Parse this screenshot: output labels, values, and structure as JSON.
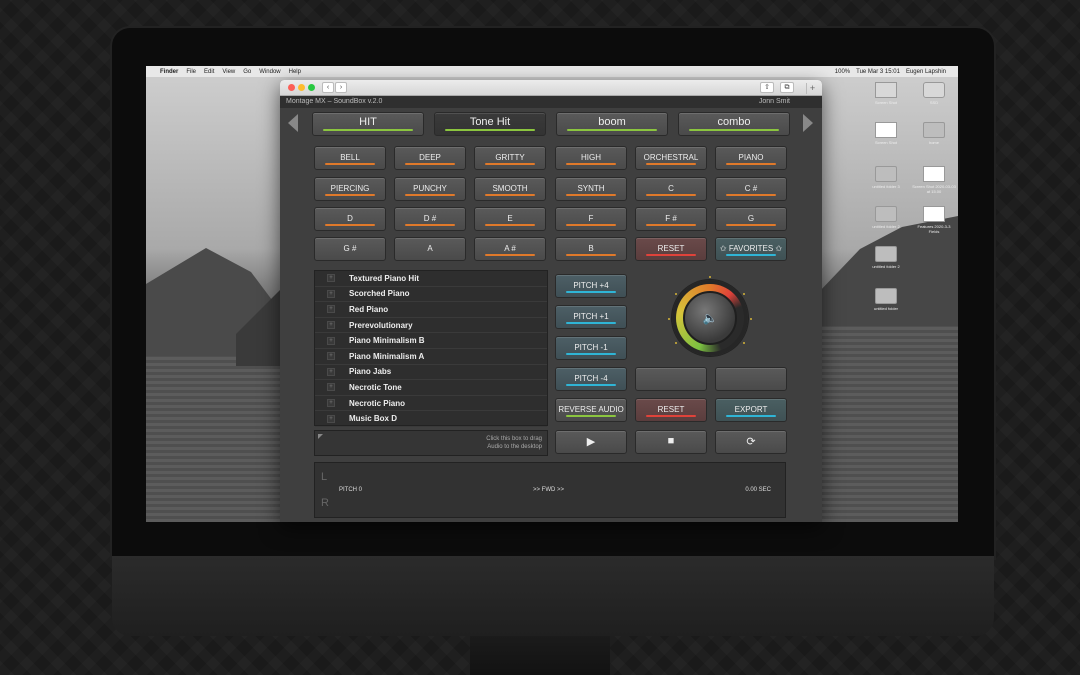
{
  "menubar": {
    "apple": "",
    "items": [
      "Finder",
      "File",
      "Edit",
      "View",
      "Go",
      "Window",
      "Help"
    ],
    "right": [
      "100%",
      "Tue Mar 3  15:01",
      "Eugen Lapshin"
    ]
  },
  "desktop": {
    "icons": [
      "Screen Shot",
      "SSD",
      "Screen Shot",
      "home",
      "untitled folder 3",
      "Screen Shot 2020-03-03 at 15.00",
      "untitled folder 2",
      "Features 2020-3-3 Fields",
      "untitled folder 2",
      "untitled folder"
    ]
  },
  "app": {
    "title": "Montage MX – SoundBox v.2.0",
    "user": "Jonn Smit",
    "categories": [
      {
        "label": "HIT",
        "bar": "green"
      },
      {
        "label": "Tone Hit",
        "bar": "green",
        "active": true
      },
      {
        "label": "boom",
        "bar": "green"
      },
      {
        "label": "combo",
        "bar": "green"
      }
    ],
    "tags": [
      [
        "BELL",
        "DEEP",
        "GRITTY",
        "HIGH",
        "ORCHESTRAL",
        "PIANO"
      ],
      [
        "PIERCING",
        "PUNCHY",
        "SMOOTH",
        "SYNTH",
        "C",
        "C #"
      ],
      [
        "D",
        "D #",
        "E",
        "F",
        "F #",
        "G"
      ],
      [
        "G #",
        "A",
        "A #",
        "B",
        "RESET",
        "✩ FAVORITES ✩"
      ]
    ],
    "presets": [
      "Textured Piano Hit",
      "Scorched Piano",
      "Red Piano",
      "Prerevolutionary",
      "Piano Minimalism B",
      "Piano Minimalism A",
      "Piano Jabs",
      "Necrotic Tone",
      "Necrotic Piano",
      "Music Box D"
    ],
    "drag_hint_line1": "Click this box to drag",
    "drag_hint_line2": "Audio to the desktop",
    "pitch_buttons": [
      "PITCH +4",
      "PITCH +1",
      "PITCH -1",
      "PITCH -4"
    ],
    "reverse_label": "REVERSE AUDIO",
    "reset_label": "RESET",
    "export_label": "EXPORT",
    "volume_icon": "speaker-icon",
    "meter": {
      "left_label": "L",
      "right_label": "R",
      "pitch": "PITCH 0",
      "direction": ">> FWD >>",
      "time": "0.00 SEC"
    }
  }
}
